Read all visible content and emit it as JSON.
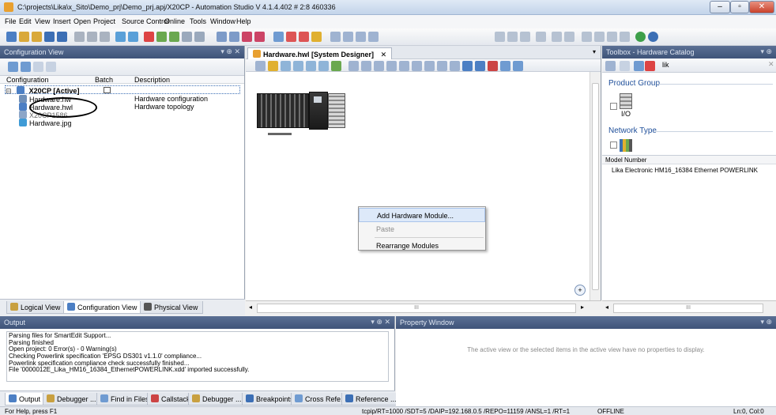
{
  "window": {
    "title": "C:\\projects\\Lika\\x_Sito\\Demo_prj\\Demo_prj.apj/X20CP - Automation Studio V 4.1.4.402 # 2:8 460336"
  },
  "menu": [
    "File",
    "Edit",
    "View",
    "Insert",
    "Open",
    "Project",
    "Source Control",
    "Online",
    "Tools",
    "Window",
    "Help"
  ],
  "config_view": {
    "title": "Configuration View",
    "pin": "▾ ⊕ ✕",
    "columns": {
      "configuration": "Configuration",
      "batch": "Batch",
      "description": "Description"
    },
    "root": "X20CP [Active]",
    "items": [
      {
        "label": "Hardware.hw",
        "description": "Hardware configuration"
      },
      {
        "label": "Hardware.hwl",
        "description": "Hardware topology"
      },
      {
        "label": "X20CP1586",
        "description": ""
      },
      {
        "label": "Hardware.jpg",
        "description": ""
      }
    ],
    "tabs": [
      "Logical View",
      "Configuration View",
      "Physical View"
    ]
  },
  "designer": {
    "tab_title": "Hardware.hwl [System Designer]",
    "tab_close": "✕",
    "context_menu": [
      "Add Hardware Module...",
      "Paste",
      "Rearrange Modules"
    ],
    "scroll_mark": "III"
  },
  "toolbox": {
    "title": "Toolbox - Hardware Catalog",
    "search_value": "lik",
    "product_group": "Product Group",
    "io_label": "I/O",
    "network_type": "Network Type",
    "model_number_header": "Model Number",
    "model_item": "Lika Electronic HM16_16384 Ethernet POWERLINK",
    "scroll_mark": "III"
  },
  "output": {
    "title": "Output",
    "lines": [
      "Parsing files for SmartEdit Support...",
      "Parsing finished",
      "Open project: 0 Error(s) - 0 Warning(s)",
      "Checking Powerlink specification 'EPSG DS301 v1.1.0' compliance...",
      "Powerlink specification compliance check successfully finished...",
      "File '0000012E_Lika_HM16_16384_EthernetPOWERLINK.xdd' imported successfully."
    ],
    "tabs": [
      "Output",
      "Debugger ...",
      "Find in Files",
      "Callstack",
      "Debugger ...",
      "Breakpoints",
      "Cross Refe...",
      "Reference ..."
    ]
  },
  "property_window": {
    "title": "Property Window",
    "empty_message": "The active view or the selected items in the active view have no properties to display."
  },
  "status": {
    "help": "For Help, press F1",
    "connection": "tcpip/RT=1000 /SDT=5 /DAIP=192.168.0.5 /REPO=11159 /ANSL=1 /RT=1",
    "mode": "OFFLINE",
    "position": "Ln:0, Col:0"
  },
  "colors": {
    "accent": "#3f5479",
    "selection": "#dde9f9"
  }
}
